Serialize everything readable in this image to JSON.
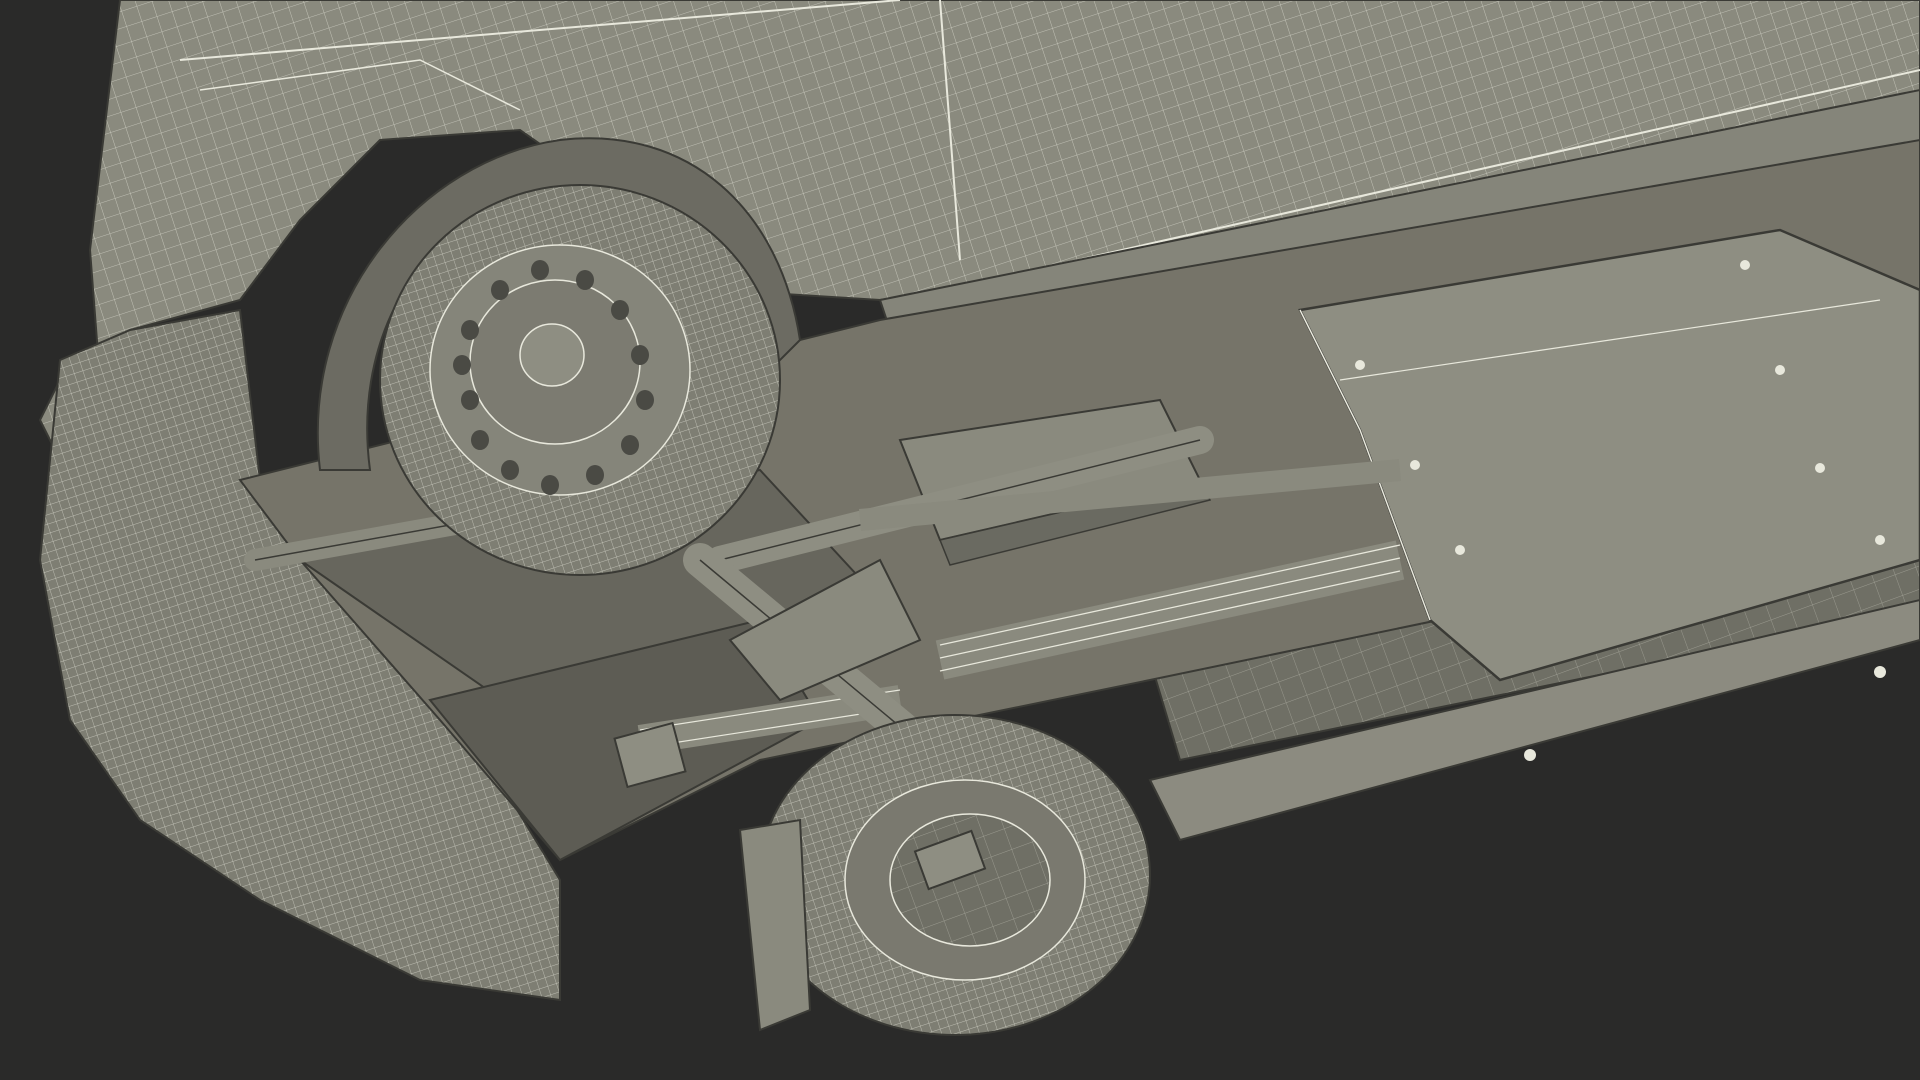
{
  "scene": {
    "subject": "van-underside-wireframe-render",
    "colors": {
      "background": "#2a2a29",
      "body_fill": "#8a8a7e",
      "body_shade": "#6f6f65",
      "body_dark": "#55554d",
      "wire": "#e8e8dc",
      "edge": "#3a3a35"
    },
    "elements": [
      "van-body",
      "front-wheel",
      "rear-wheel",
      "fuel-tank-panel",
      "exhaust-muffler",
      "leaf-spring",
      "drive-shaft",
      "rear-axle",
      "side-skirt"
    ]
  }
}
